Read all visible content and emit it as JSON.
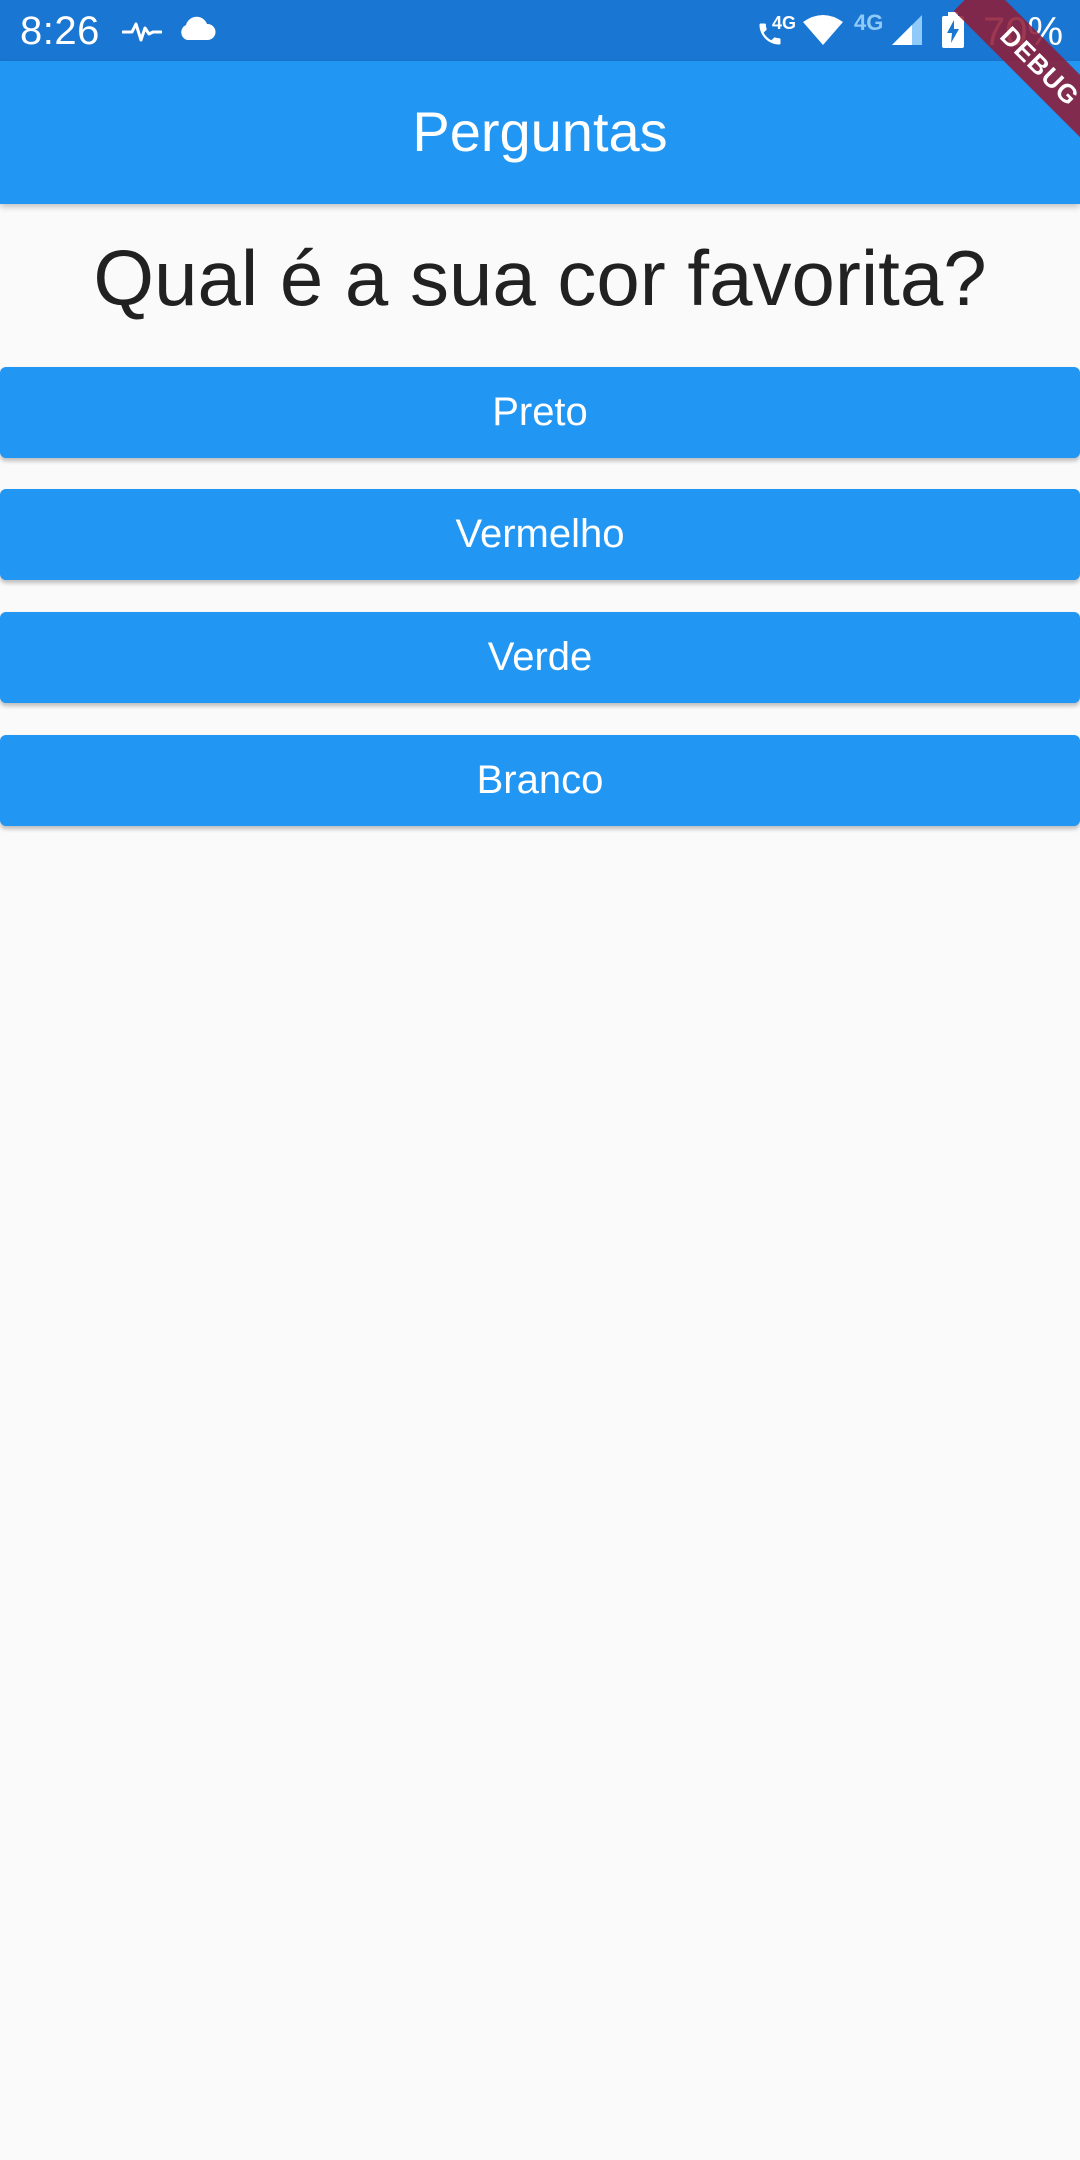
{
  "status_bar": {
    "time": "8:26",
    "battery": "70%",
    "call_tech": "4G",
    "mobile_tech": "4G",
    "icons": [
      "activity-icon",
      "cloud-icon",
      "volte-call-icon",
      "wifi-icon",
      "signal-icon",
      "battery-charging-icon"
    ]
  },
  "debug_banner": "DEBUG",
  "app_bar": {
    "title": "Perguntas"
  },
  "question": "Qual é a sua cor favorita?",
  "answers": [
    "Preto",
    "Vermelho",
    "Verde",
    "Branco"
  ],
  "colors": {
    "primary": "#2196f3",
    "status_bar": "#1976d2",
    "background": "#fafafa",
    "text": "#212121",
    "debug_banner": "#8e1e38"
  }
}
